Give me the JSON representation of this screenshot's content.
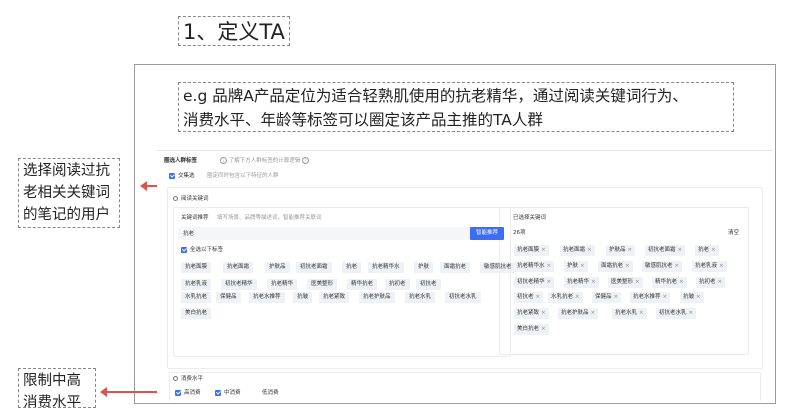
{
  "slide": {
    "title": "1、定义TA",
    "description_line1": "e.g 品牌A产品定位为适合轻熟肌使用的抗老精华，通过阅读关键词行为、",
    "description_line2": "消费水平、年龄等标签可以圈定该产品主推的TA人群"
  },
  "notes": {
    "note1_line1": "选择阅读过抗",
    "note1_line2": "老相关关键词",
    "note1_line3": "的笔记的用户",
    "note2_line1": "限制中高",
    "note2_line2": "消费水平"
  },
  "panel": {
    "header_title": "圈选人群标签",
    "header_hint": "了解下方人群标签的计算逻辑",
    "intersection_label": "交集选",
    "intersection_hint": "圈定同时包含以下特征的人群",
    "reading_section": "阅读关键词",
    "keyword_recommend": "关键词推荐",
    "keyword_recommend_hint": "填写场景、品牌等描述词，智能推荐关联词",
    "search_value": "抗老",
    "search_button": "智能推荐",
    "select_all": "全选以下标签",
    "keyword_tags": [
      [
        "抗老面膜",
        "抗老面霜",
        "护肤品",
        "初抗老面霜",
        "抗老",
        "抗老精华水",
        "护肤",
        "面霜抗老",
        "敏感肌抗老"
      ],
      [
        "抗老乳液",
        "初抗老精华",
        "抗老精华",
        "医美整形",
        "精华抗老",
        "抗初老",
        "初抗老"
      ],
      [
        "水乳抗老",
        "保健品",
        "抗老水推荐",
        "抗皱",
        "抗老紧致",
        "抗老护肤品",
        "抗老水乳",
        "初抗老水乳"
      ],
      [
        "美白抗老"
      ]
    ],
    "selected_title": "已选择关键词",
    "selected_count": "26项",
    "clear_label": "清空",
    "selected_tags": [
      [
        "抗老面膜",
        "抗老面霜",
        "护肤品",
        "初抗老面霜",
        "抗老"
      ],
      [
        "抗老精华水",
        "护肤",
        "面霜抗老",
        "敏感肌抗老",
        "抗老乳液"
      ],
      [
        "初抗老精华",
        "抗老精华",
        "医美整形",
        "精华抗老",
        "抗初老"
      ],
      [
        "初抗老",
        "水乳抗老",
        "保健品",
        "抗老水推荐",
        "抗皱"
      ],
      [
        "抗老紧致",
        "抗老护肤品",
        "抗老水乳",
        "初抗老水乳"
      ],
      [
        "美白抗老"
      ]
    ],
    "consumption_section": "消费水平",
    "consumption_options": [
      "高消费",
      "中消费",
      "低消费"
    ]
  },
  "colors": {
    "accent": "#3b6ef5",
    "arrow": "#d9534f",
    "tag_bg": "#eef1f6"
  }
}
